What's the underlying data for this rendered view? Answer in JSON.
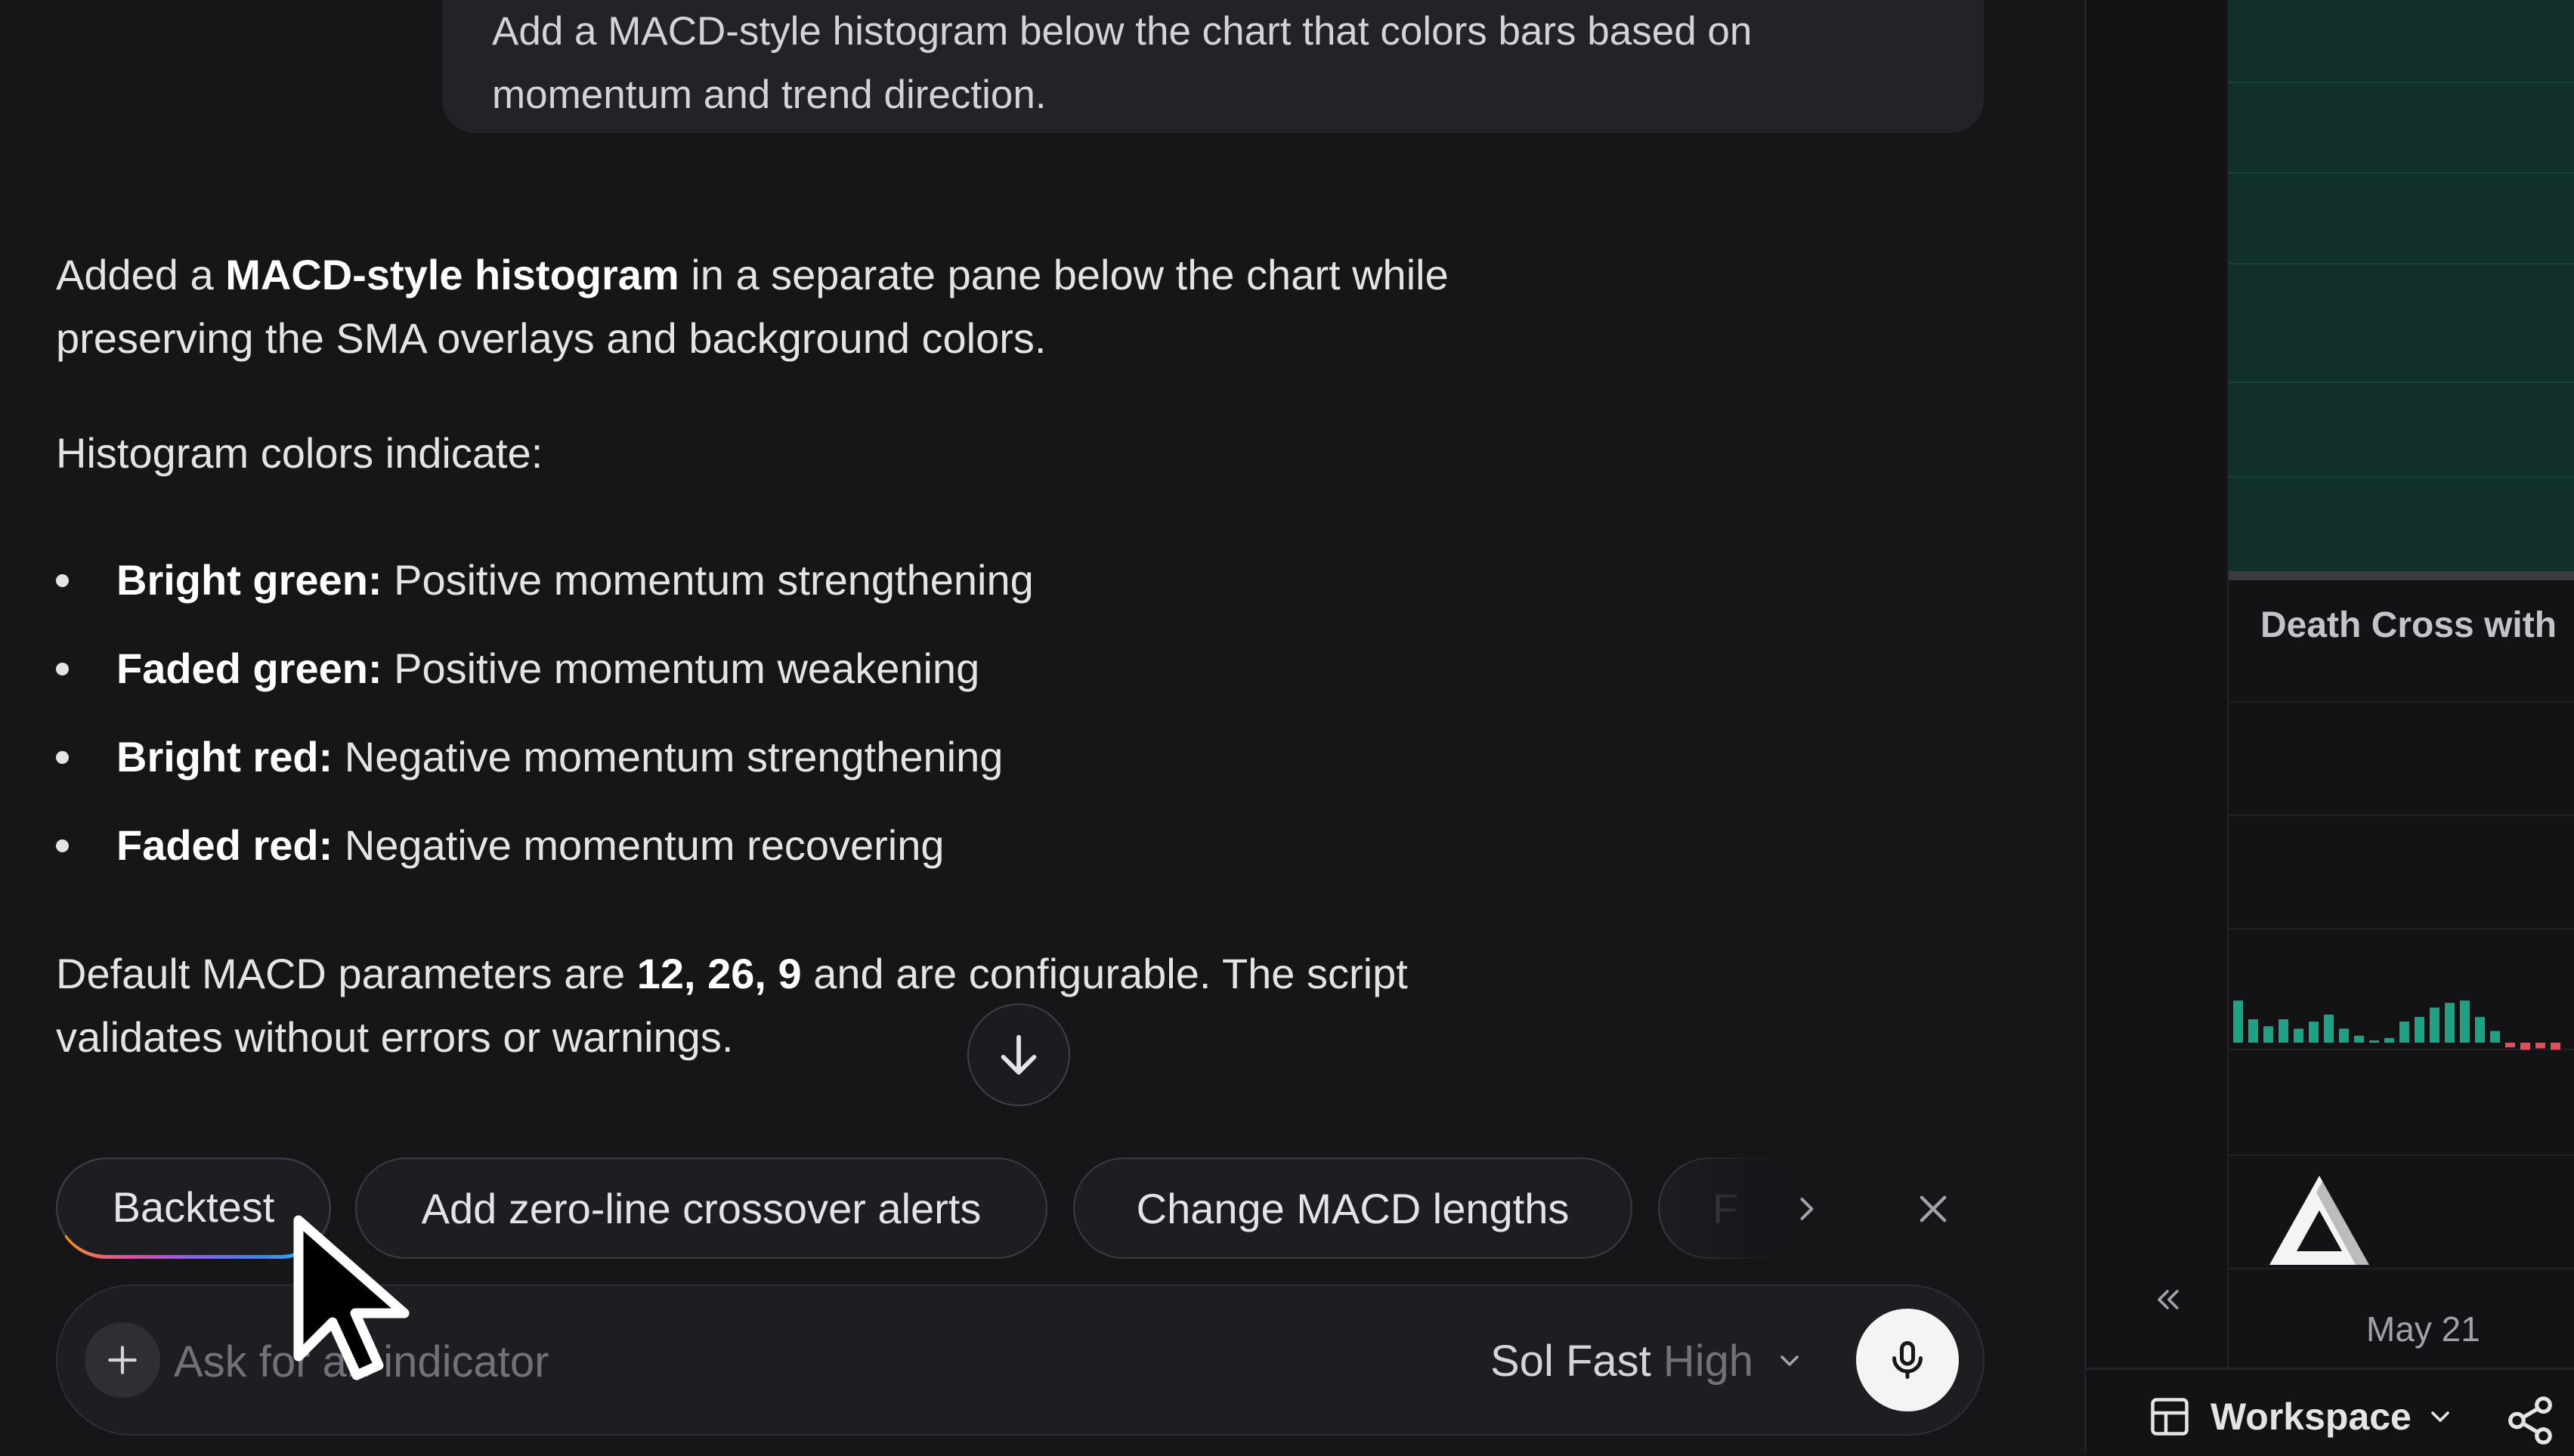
{
  "chat": {
    "user_message": "Add a MACD-style histogram below the chart that colors bars based on momentum and trend direction.",
    "intro_prefix": "Added a ",
    "intro_bold": "MACD-style histogram",
    "intro_suffix": " in a separate pane below the chart while preserving the SMA overlays and background colors.",
    "colors_heading": "Histogram colors indicate:",
    "bullets": [
      {
        "label": "Bright green:",
        "text": " Positive momentum strengthening"
      },
      {
        "label": "Faded green:",
        "text": " Positive momentum weakening"
      },
      {
        "label": "Bright red:",
        "text": " Negative momentum strengthening"
      },
      {
        "label": "Faded red:",
        "text": " Negative momentum recovering"
      }
    ],
    "params_prefix": "Default MACD parameters are ",
    "params_bold": "12, 26, 9",
    "params_suffix": " and are configurable. The script validates without errors or warnings."
  },
  "suggestions": {
    "chips": [
      "Backtest",
      "Add zero-line crossover alerts",
      "Change MACD lengths",
      "F"
    ]
  },
  "composer": {
    "placeholder": "Ask for an indicator",
    "model_name": "Sol Fast",
    "model_level": "High"
  },
  "side_panel": {
    "indicator_title": "Death Cross with",
    "date_label": "May 21",
    "workspace_label": "Workspace",
    "histogram": [
      0.9,
      0.5,
      0.35,
      0.5,
      0.3,
      0.45,
      0.6,
      0.3,
      0.15,
      0.05,
      0.1,
      0.45,
      0.55,
      0.75,
      0.85,
      0.9,
      0.55,
      0.25,
      -0.1,
      -0.15,
      -0.12,
      -0.15
    ]
  },
  "colors": {
    "chart_bg": "#12302a",
    "hist_positive": "#1ea286",
    "hist_negative": "#e0505a"
  }
}
